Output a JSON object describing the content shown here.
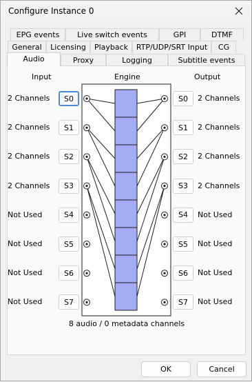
{
  "window": {
    "title": "Configure Instance 0"
  },
  "tabs": {
    "row1": [
      "EPG events",
      "Live switch events",
      "GPI",
      "DTMF"
    ],
    "row2": [
      "General",
      "Licensing",
      "Playback",
      "RTP/UDP/SRT Input",
      "CG"
    ],
    "row3": [
      "Audio",
      "Proxy",
      "Logging",
      "Subtitle events"
    ],
    "active": "Audio"
  },
  "audio": {
    "input_header": "Input",
    "engine_header": "Engine",
    "output_header": "Output",
    "inputs": [
      {
        "label": "2 Channels",
        "button": "S0"
      },
      {
        "label": "2 Channels",
        "button": "S1"
      },
      {
        "label": "2 Channels",
        "button": "S2"
      },
      {
        "label": "2 Channels",
        "button": "S3"
      },
      {
        "label": "Not Used",
        "button": "S4"
      },
      {
        "label": "Not Used",
        "button": "S5"
      },
      {
        "label": "Not Used",
        "button": "S6"
      },
      {
        "label": "Not Used",
        "button": "S7"
      }
    ],
    "outputs": [
      {
        "label": "2 Channels",
        "button": "S0"
      },
      {
        "label": "2 Channels",
        "button": "S1"
      },
      {
        "label": "2 Channels",
        "button": "S2"
      },
      {
        "label": "2 Channels",
        "button": "S3"
      },
      {
        "label": "Not Used",
        "button": "S4"
      },
      {
        "label": "Not Used",
        "button": "S5"
      },
      {
        "label": "Not Used",
        "button": "S6"
      },
      {
        "label": "Not Used",
        "button": "S7"
      }
    ],
    "engine_slots": 8,
    "input_routing": [
      [
        0,
        0
      ],
      [
        0,
        1
      ],
      [
        1,
        2
      ],
      [
        1,
        3
      ],
      [
        2,
        4
      ],
      [
        2,
        5
      ],
      [
        3,
        6
      ],
      [
        3,
        7
      ]
    ],
    "output_routing": [
      [
        0,
        0
      ],
      [
        1,
        0
      ],
      [
        2,
        1
      ],
      [
        3,
        1
      ],
      [
        4,
        2
      ],
      [
        5,
        2
      ],
      [
        6,
        3
      ],
      [
        7,
        3
      ]
    ],
    "summary": "8 audio / 0 metadata channels",
    "colors": {
      "engine_slot": "#a4acf6",
      "engine_border": "#1e1e1e",
      "focus": "#4a8ad6"
    }
  },
  "footer": {
    "ok_label": "OK",
    "cancel_label": "Cancel"
  }
}
